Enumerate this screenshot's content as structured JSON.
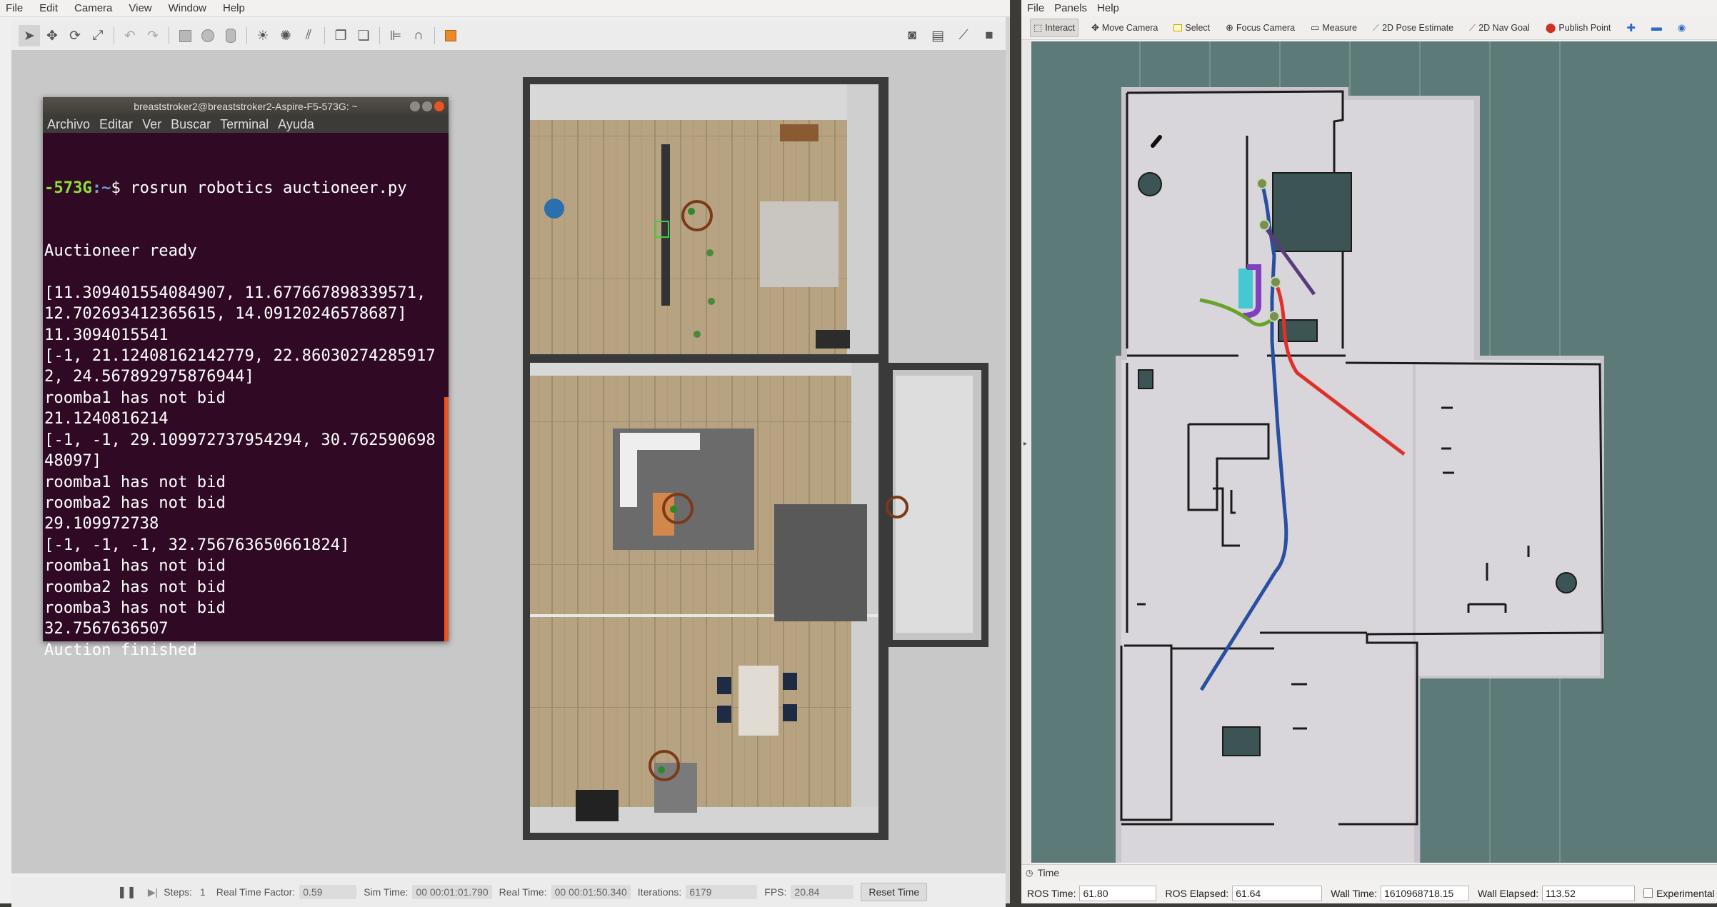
{
  "gazebo": {
    "menu": [
      "File",
      "Edit",
      "Camera",
      "View",
      "Window",
      "Help"
    ],
    "toolbar_icons": [
      "select-arrow-icon",
      "translate-icon",
      "rotate-icon",
      "scale-icon",
      "undo-icon",
      "redo-icon",
      "box-icon",
      "sphere-icon",
      "cylinder-icon",
      "point-light-icon",
      "spot-light-icon",
      "directional-light-icon",
      "copy-icon",
      "paste-icon",
      "align-icon",
      "snap-icon",
      "color-icon"
    ],
    "toolbar_right_icons": [
      "screenshot-icon",
      "log-icon",
      "plot-icon",
      "record-icon"
    ],
    "status": {
      "steps_label": "Steps:",
      "steps_value": "1",
      "rtf_label": "Real Time Factor:",
      "rtf_value": "0.59",
      "sim_time_label": "Sim Time:",
      "sim_time_value": "00 00:01:01.790",
      "real_time_label": "Real Time:",
      "real_time_value": "00 00:01:50.340",
      "iterations_label": "Iterations:",
      "iterations_value": "6179",
      "fps_label": "FPS:",
      "fps_value": "20.84",
      "reset_label": "Reset Time"
    }
  },
  "terminal": {
    "title": "breaststroker2@breaststroker2-Aspire-F5-573G: ~",
    "menu": [
      "Archivo",
      "Editar",
      "Ver",
      "Buscar",
      "Terminal",
      "Ayuda"
    ],
    "prompt_host": "-573G",
    "prompt_path": ":~",
    "prompt_symbol": "$",
    "command": " rosrun robotics auctioneer.py",
    "output": "Auctioneer ready\n\n[11.309401554084907, 11.677667898339571, 12.702693412365615, 14.09120246578687]\n11.3094015541\n[-1, 21.12408162142779, 22.860302742859172, 24.567892975876944]\nroomba1 has not bid\n21.1240816214\n[-1, -1, 29.109972737954294, 30.76259069848097]\nroomba1 has not bid\nroomba2 has not bid\n29.109972738\n[-1, -1, -1, 32.756763650661824]\nroomba1 has not bid\nroomba2 has not bid\nroomba3 has not bid\n32.7567636507\nAuction finished"
  },
  "rviz": {
    "menu": [
      "File",
      "Panels",
      "Help"
    ],
    "tools": [
      {
        "label": "Interact",
        "icon": "interact-icon",
        "active": true
      },
      {
        "label": "Move Camera",
        "icon": "move-camera-icon",
        "active": false
      },
      {
        "label": "Select",
        "icon": "select-icon",
        "active": false
      },
      {
        "label": "Focus Camera",
        "icon": "focus-camera-icon",
        "active": false
      },
      {
        "label": "Measure",
        "icon": "measure-icon",
        "active": false
      },
      {
        "label": "2D Pose Estimate",
        "icon": "pose-estimate-icon",
        "active": false
      },
      {
        "label": "2D Nav Goal",
        "icon": "nav-goal-icon",
        "active": false
      },
      {
        "label": "Publish Point",
        "icon": "publish-point-icon",
        "active": false
      }
    ],
    "path_colors": {
      "blue": "#2a4fa0",
      "red": "#e0302a",
      "purple": "#5a3a7a",
      "green": "#6aa22a"
    },
    "time_panel_label": "Time",
    "time": {
      "ros_time_label": "ROS Time:",
      "ros_time": "61.80",
      "ros_elapsed_label": "ROS Elapsed:",
      "ros_elapsed": "61.64",
      "wall_time_label": "Wall Time:",
      "wall_time": "1610968718.15",
      "wall_elapsed_label": "Wall Elapsed:",
      "wall_elapsed": "113.52",
      "experimental_label": "Experimental"
    }
  }
}
